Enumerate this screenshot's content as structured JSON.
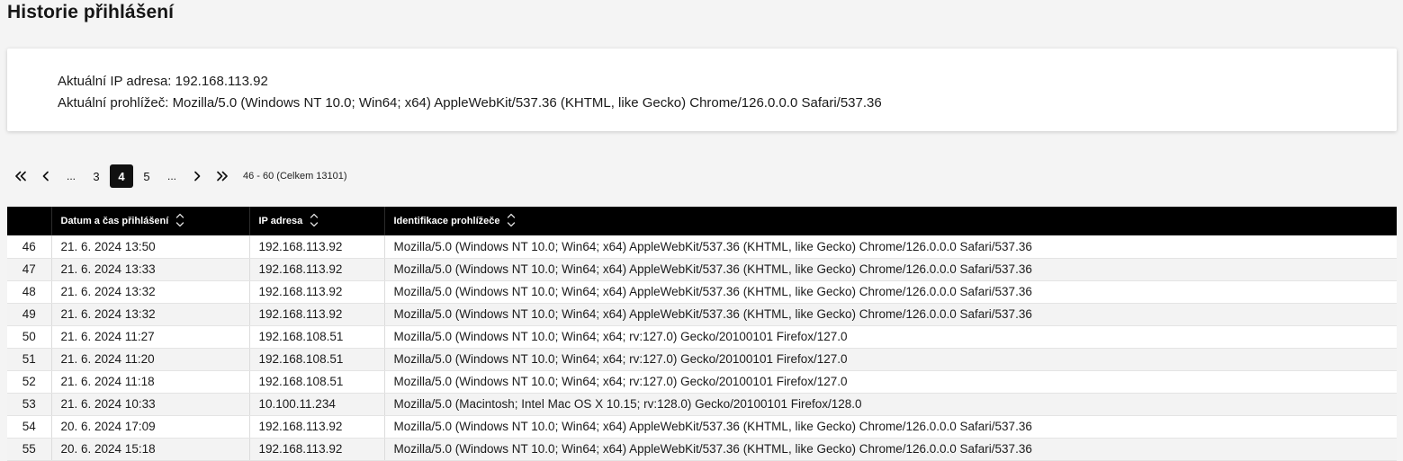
{
  "page": {
    "title": "Historie přihlášení"
  },
  "info": {
    "ip_line": "Aktuální IP adresa: 192.168.113.92",
    "browser_line": "Aktuální prohlížeč: Mozilla/5.0 (Windows NT 10.0; Win64; x64) AppleWebKit/537.36 (KHTML, like Gecko) Chrome/126.0.0.0 Safari/537.36"
  },
  "pagination": {
    "ellipsis_left": "...",
    "page_prev": "3",
    "page_current": "4",
    "page_next": "5",
    "ellipsis_right": "...",
    "range_text": "46 - 60 (Celkem 13101)"
  },
  "table": {
    "columns": {
      "num": "",
      "datetime": "Datum a čas přihlášení",
      "ip": "IP adresa",
      "browser": "Identifikace prohlížeče"
    },
    "rows": [
      {
        "num": "46",
        "datetime": "21. 6. 2024 13:50",
        "ip": "192.168.113.92",
        "browser": "Mozilla/5.0 (Windows NT 10.0; Win64; x64) AppleWebKit/537.36 (KHTML, like Gecko) Chrome/126.0.0.0 Safari/537.36"
      },
      {
        "num": "47",
        "datetime": "21. 6. 2024 13:33",
        "ip": "192.168.113.92",
        "browser": "Mozilla/5.0 (Windows NT 10.0; Win64; x64) AppleWebKit/537.36 (KHTML, like Gecko) Chrome/126.0.0.0 Safari/537.36"
      },
      {
        "num": "48",
        "datetime": "21. 6. 2024 13:32",
        "ip": "192.168.113.92",
        "browser": "Mozilla/5.0 (Windows NT 10.0; Win64; x64) AppleWebKit/537.36 (KHTML, like Gecko) Chrome/126.0.0.0 Safari/537.36"
      },
      {
        "num": "49",
        "datetime": "21. 6. 2024 13:32",
        "ip": "192.168.113.92",
        "browser": "Mozilla/5.0 (Windows NT 10.0; Win64; x64) AppleWebKit/537.36 (KHTML, like Gecko) Chrome/126.0.0.0 Safari/537.36"
      },
      {
        "num": "50",
        "datetime": "21. 6. 2024 11:27",
        "ip": "192.168.108.51",
        "browser": "Mozilla/5.0 (Windows NT 10.0; Win64; x64; rv:127.0) Gecko/20100101 Firefox/127.0"
      },
      {
        "num": "51",
        "datetime": "21. 6. 2024 11:20",
        "ip": "192.168.108.51",
        "browser": "Mozilla/5.0 (Windows NT 10.0; Win64; x64; rv:127.0) Gecko/20100101 Firefox/127.0"
      },
      {
        "num": "52",
        "datetime": "21. 6. 2024 11:18",
        "ip": "192.168.108.51",
        "browser": "Mozilla/5.0 (Windows NT 10.0; Win64; x64; rv:127.0) Gecko/20100101 Firefox/127.0"
      },
      {
        "num": "53",
        "datetime": "21. 6. 2024 10:33",
        "ip": "10.100.11.234",
        "browser": "Mozilla/5.0 (Macintosh; Intel Mac OS X 10.15; rv:128.0) Gecko/20100101 Firefox/128.0"
      },
      {
        "num": "54",
        "datetime": "20. 6. 2024 17:09",
        "ip": "192.168.113.92",
        "browser": "Mozilla/5.0 (Windows NT 10.0; Win64; x64) AppleWebKit/537.36 (KHTML, like Gecko) Chrome/126.0.0.0 Safari/537.36"
      },
      {
        "num": "55",
        "datetime": "20. 6. 2024 15:18",
        "ip": "192.168.113.92",
        "browser": "Mozilla/5.0 (Windows NT 10.0; Win64; x64) AppleWebKit/537.36 (KHTML, like Gecko) Chrome/126.0.0.0 Safari/537.36"
      }
    ]
  },
  "icons": {
    "first": "double-chevron-left-icon",
    "prev": "chevron-left-icon",
    "next": "chevron-right-icon",
    "last": "double-chevron-right-icon",
    "sort": "sort-up-down-icon"
  },
  "colors": {
    "header_bg": "#000000",
    "active_page_bg": "#111111",
    "row_alt_bg": "#f3f3f3",
    "page_bg": "#f4f4f4"
  }
}
